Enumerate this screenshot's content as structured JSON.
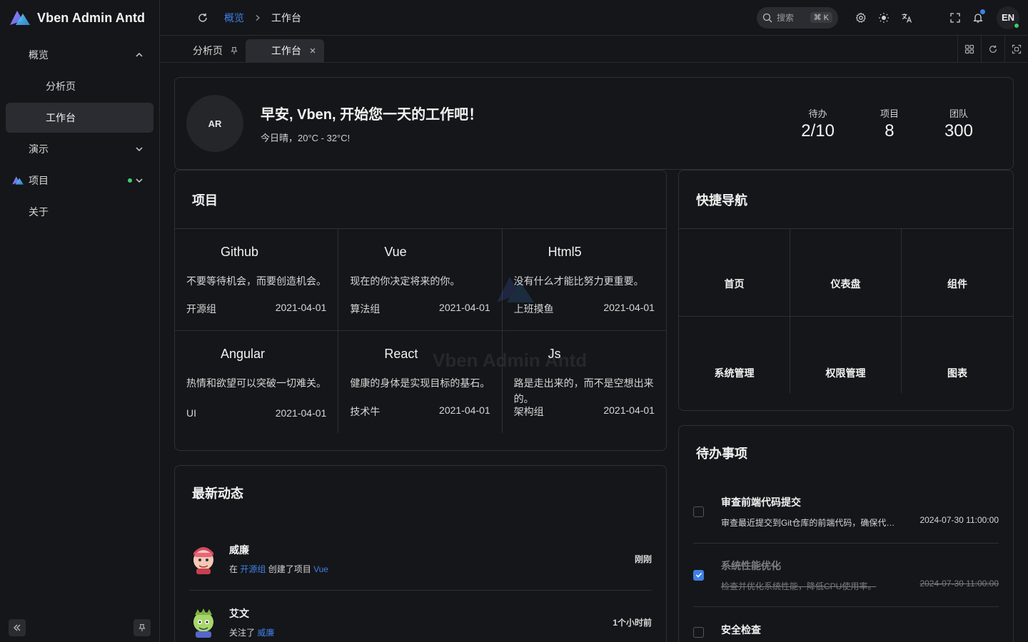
{
  "app": {
    "name": "Vben Admin Antd",
    "watermark": "Vben Admin Antd"
  },
  "colors": {
    "accent": "#3f7fe6",
    "online": "#43c970",
    "background": "#151619",
    "card_border": "#2e3035"
  },
  "sidebar": {
    "items": [
      {
        "label": "概览",
        "expanded": true
      },
      {
        "label": "分析页"
      },
      {
        "label": "工作台",
        "active": true
      },
      {
        "label": "演示"
      },
      {
        "label": "项目"
      },
      {
        "label": "关于"
      }
    ],
    "icons": {
      "collapse": "double-chevron-left-icon",
      "pin": "pin-icon"
    }
  },
  "header": {
    "breadcrumb": {
      "parent": "概览",
      "current": "工作台"
    },
    "search": {
      "label": "搜索",
      "shortcut": "⌘ K"
    },
    "language": "EN",
    "icons": [
      "refresh-icon",
      "search-icon",
      "gear-icon",
      "sun-icon",
      "translate-icon",
      "fullscreen-icon",
      "bell-icon"
    ]
  },
  "tabs": {
    "items": [
      {
        "label": "分析页",
        "icon": "pin-icon"
      },
      {
        "label": "工作台",
        "icon": "close-icon",
        "active": true
      }
    ],
    "tools": [
      "grid-icon",
      "refresh-icon",
      "maximize-icon"
    ]
  },
  "welcome": {
    "avatar": "AR",
    "title": "早安, Vben, 开始您一天的工作吧！",
    "subtitle": "今日晴，20°C - 32°C!",
    "stats": [
      {
        "label": "待办",
        "value": "2/10"
      },
      {
        "label": "项目",
        "value": "8"
      },
      {
        "label": "团队",
        "value": "300"
      }
    ]
  },
  "projects": {
    "title": "项目",
    "items": [
      {
        "name": "Github",
        "desc": "不要等待机会，而要创造机会。",
        "group": "开源组",
        "date": "2021-04-01"
      },
      {
        "name": "Vue",
        "desc": "现在的你决定将来的你。",
        "group": "算法组",
        "date": "2021-04-01"
      },
      {
        "name": "Html5",
        "desc": "没有什么才能比努力更重要。",
        "group": "上班摸鱼",
        "date": "2021-04-01"
      },
      {
        "name": "Angular",
        "desc": "热情和欲望可以突破一切难关。",
        "group": "UI",
        "date": "2021-04-01"
      },
      {
        "name": "React",
        "desc": "健康的身体是实现目标的基石。",
        "group": "技术牛",
        "date": "2021-04-01"
      },
      {
        "name": "Js",
        "desc": "路是走出来的，而不是空想出来的。",
        "group": "架构组",
        "date": "2021-04-01"
      }
    ]
  },
  "quick_nav": {
    "title": "快捷导航",
    "items": [
      "首页",
      "仪表盘",
      "组件",
      "系统管理",
      "权限管理",
      "图表"
    ]
  },
  "activity": {
    "title": "最新动态",
    "items": [
      {
        "name": "威廉",
        "prefix": "在",
        "link1": "开源组",
        "middle": "创建了项目",
        "link2": "Vue",
        "time": "刚刚"
      },
      {
        "name": "艾文",
        "prefix": "关注了",
        "link1": "威廉",
        "middle": "",
        "link2": "",
        "time": "1个小时前"
      }
    ]
  },
  "todo": {
    "title": "待办事项",
    "items": [
      {
        "name": "审查前端代码提交",
        "desc": "审查最近提交到Git仓库的前端代码，确保代码质量和规范。",
        "date": "2024-07-30 11:00:00",
        "done": false
      },
      {
        "name": "系统性能优化",
        "desc": "检查并优化系统性能，降低CPU使用率。",
        "date": "2024-07-30 11:00:00",
        "done": true
      },
      {
        "name": "安全检查",
        "desc": "",
        "date": "",
        "done": false
      }
    ]
  }
}
